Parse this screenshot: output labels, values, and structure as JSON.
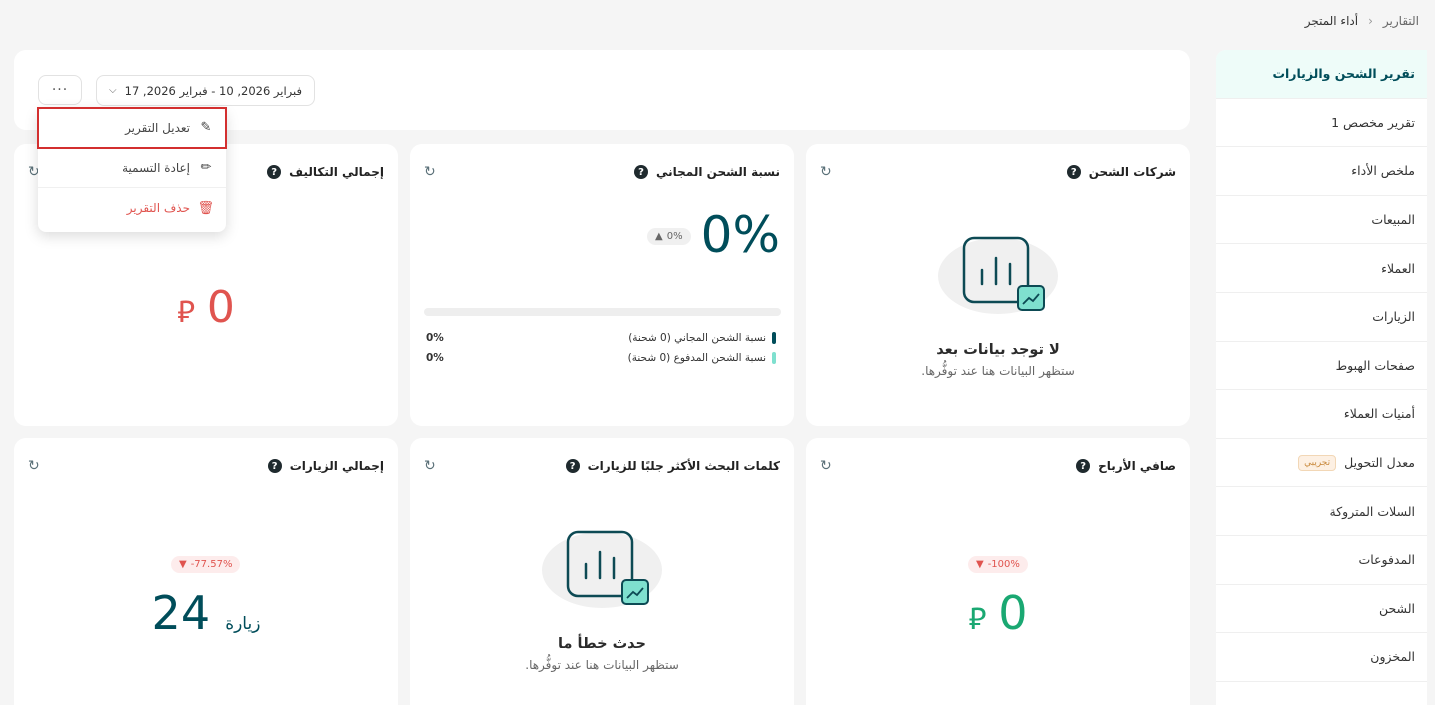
{
  "breadcrumb": {
    "root": "التقارير",
    "current": "أداء المتجر"
  },
  "sidebar": {
    "items": [
      {
        "label": "تقرير الشحن والزيارات"
      },
      {
        "label": "تقرير مخصص 1"
      },
      {
        "label": "ملخص الأداء"
      },
      {
        "label": "المبيعات"
      },
      {
        "label": "العملاء"
      },
      {
        "label": "الزيارات"
      },
      {
        "label": "صفحات الهبوط"
      },
      {
        "label": "أمنيات العملاء"
      },
      {
        "label": "معدل التحويل",
        "badge": "تجريبي"
      },
      {
        "label": "السلات المتروكة"
      },
      {
        "label": "المدفوعات"
      },
      {
        "label": "الشحن"
      },
      {
        "label": "المخزون"
      }
    ]
  },
  "filter": {
    "date_range": "فبراير 2026, 10  -  فبراير 2026, 17",
    "more": "···"
  },
  "menu": {
    "edit": "تعديل التقرير",
    "rename": "إعادة التسمية",
    "delete": "حذف التقرير"
  },
  "currency_symbol": "⃁",
  "cards": {
    "shipping_companies": {
      "title": "شركات الشحن",
      "empty_title": "لا توجد بيانات بعد",
      "empty_sub": "ستظهر البيانات هنا عند توفُّرها."
    },
    "free_shipping": {
      "title": "نسبة الشحن المجاني",
      "value": "0%",
      "trend": "0%",
      "progress": 0,
      "legend": [
        {
          "label": "نسبة الشحن المجاني (0 شحنة)",
          "value": "0%",
          "color": "#004d5a"
        },
        {
          "label": "نسبة الشحن المدفوع (0 شحنة)",
          "value": "0%",
          "color": "#7fe0cf"
        }
      ]
    },
    "total_costs": {
      "title": "إجمالي التكاليف",
      "value": "0"
    },
    "net_profit": {
      "title": "صافي الأرباح",
      "value": "0",
      "trend": "-100%"
    },
    "top_keywords": {
      "title": "كلمات البحث الأكثر جلبًا للزيارات",
      "empty_title": "حدث خطأ ما",
      "empty_sub": "ستظهر البيانات هنا عند توفُّرها."
    },
    "total_visits": {
      "title": "إجمالي الزيارات",
      "value": "24",
      "unit": "زيارة",
      "trend": "-77.57%"
    }
  },
  "colors": {
    "primary": "#004d5a",
    "red": "#e0544f",
    "green": "#1aa872",
    "mint": "#7fe0cf"
  }
}
